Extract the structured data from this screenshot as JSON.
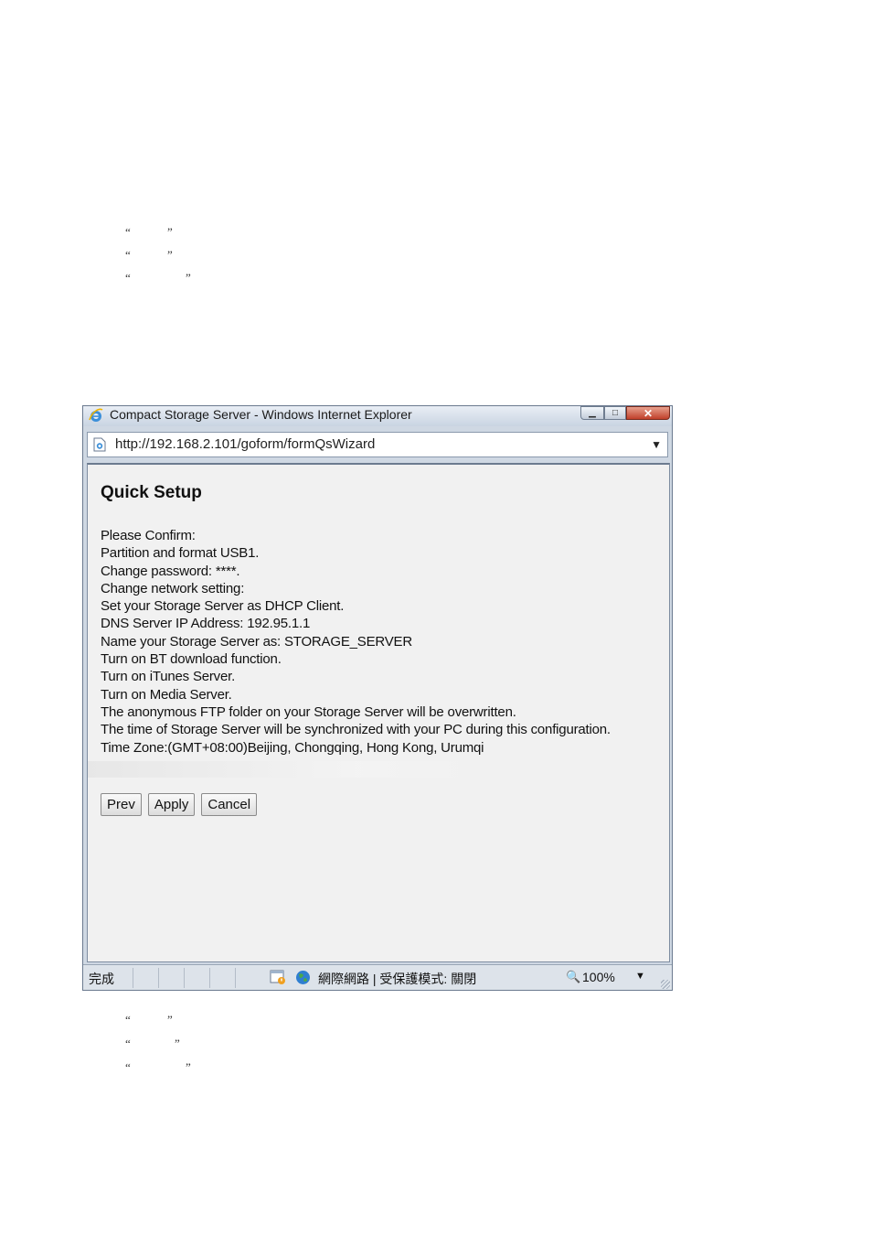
{
  "doc_quotes": {
    "open": "“",
    "close": "”"
  },
  "window": {
    "title": "Compact Storage Server - Windows Internet Explorer",
    "url": "http://192.168.2.101/goform/formQsWizard"
  },
  "page": {
    "heading": "Quick Setup",
    "lines": [
      "Please Confirm:",
      "Partition and format USB1.",
      "Change password: ****.",
      "Change network setting:",
      "Set your Storage Server as DHCP Client.",
      "DNS Server IP Address: 192.95.1.1",
      "Name your Storage Server as: STORAGE_SERVER",
      "Turn on BT download function.",
      "Turn on iTunes Server.",
      "Turn on Media Server.",
      "The anonymous FTP folder on your Storage Server will be overwritten.",
      "The time of Storage Server will be synchronized with your PC during this configuration.",
      "Time Zone:(GMT+08:00)Beijing, Chongqing, Hong Kong, Urumqi"
    ],
    "buttons": {
      "prev": "Prev",
      "apply": "Apply",
      "cancel": "Cancel"
    }
  },
  "status_bar": {
    "status": "完成",
    "zone": "網際網路 | 受保護模式: 關閉",
    "zoom": "100%"
  },
  "icons": {
    "browser": "ie-logo-icon",
    "page": "ie-page-icon",
    "protected_mode": "protected-mode-icon",
    "zone": "globe-icon",
    "zoom": "magnifier-icon"
  }
}
